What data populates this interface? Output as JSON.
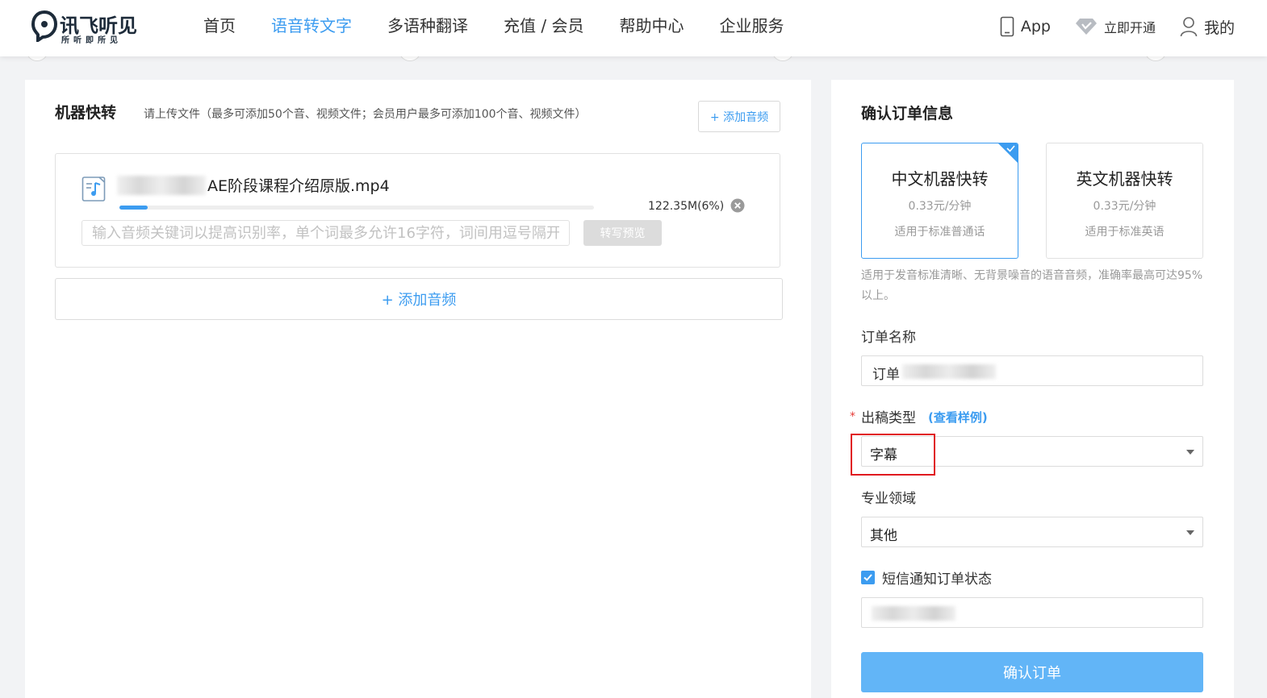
{
  "header": {
    "logo": {
      "name": "讯飞听见",
      "slogan": "所听即所见"
    },
    "nav": [
      {
        "label": "首页",
        "active": false
      },
      {
        "label": "语音转文字",
        "active": true
      },
      {
        "label": "多语种翻译",
        "active": false
      },
      {
        "label": "充值 / 会员",
        "active": false
      },
      {
        "label": "帮助中心",
        "active": false
      },
      {
        "label": "企业服务",
        "active": false
      }
    ],
    "app_label": "App",
    "vip_label": "立即开通",
    "me_label": "我的"
  },
  "upload": {
    "title": "机器快转",
    "hint": "请上传文件（最多可添加50个音、视频文件；会员用户最多可添加100个音、视频文件）",
    "add_button_small": "+ 添加音频",
    "file": {
      "name": "AE阶段课程介绍原版.mp4",
      "size_label": "122.35M(6%)",
      "progress": 0.06,
      "keyword_placeholder": "输入音频关键词以提高识别率，单个词最多允许16字符，词间用逗号隔开。",
      "preview_button": "转写预览"
    },
    "add_button_large": "+ 添加音频"
  },
  "order": {
    "title": "确认订单信息",
    "services": [
      {
        "name": "中文机器快转",
        "price": "0.33元/分钟",
        "desc": "适用于标准普通话",
        "selected": true
      },
      {
        "name": "英文机器快转",
        "price": "0.33元/分钟",
        "desc": "适用于标准英语",
        "selected": false
      }
    ],
    "note": "适用于发音标准清晰、无背景噪音的语音音频，准确率最高可达95% 以上。",
    "order_name_label": "订单名称",
    "order_name_value": "订单",
    "output_type_label": "出稿类型",
    "required_mark": "*",
    "sample_link": "(查看样例)",
    "output_type_value": "字幕",
    "domain_label": "专业领域",
    "domain_value": "其他",
    "sms_label": "短信通知订单状态",
    "sms_checked": true,
    "confirm_button": "确认订单"
  },
  "colors": {
    "accent": "#3c9cf0",
    "confirm_bg": "#62b5f7",
    "highlight_box": "#e0191f"
  }
}
